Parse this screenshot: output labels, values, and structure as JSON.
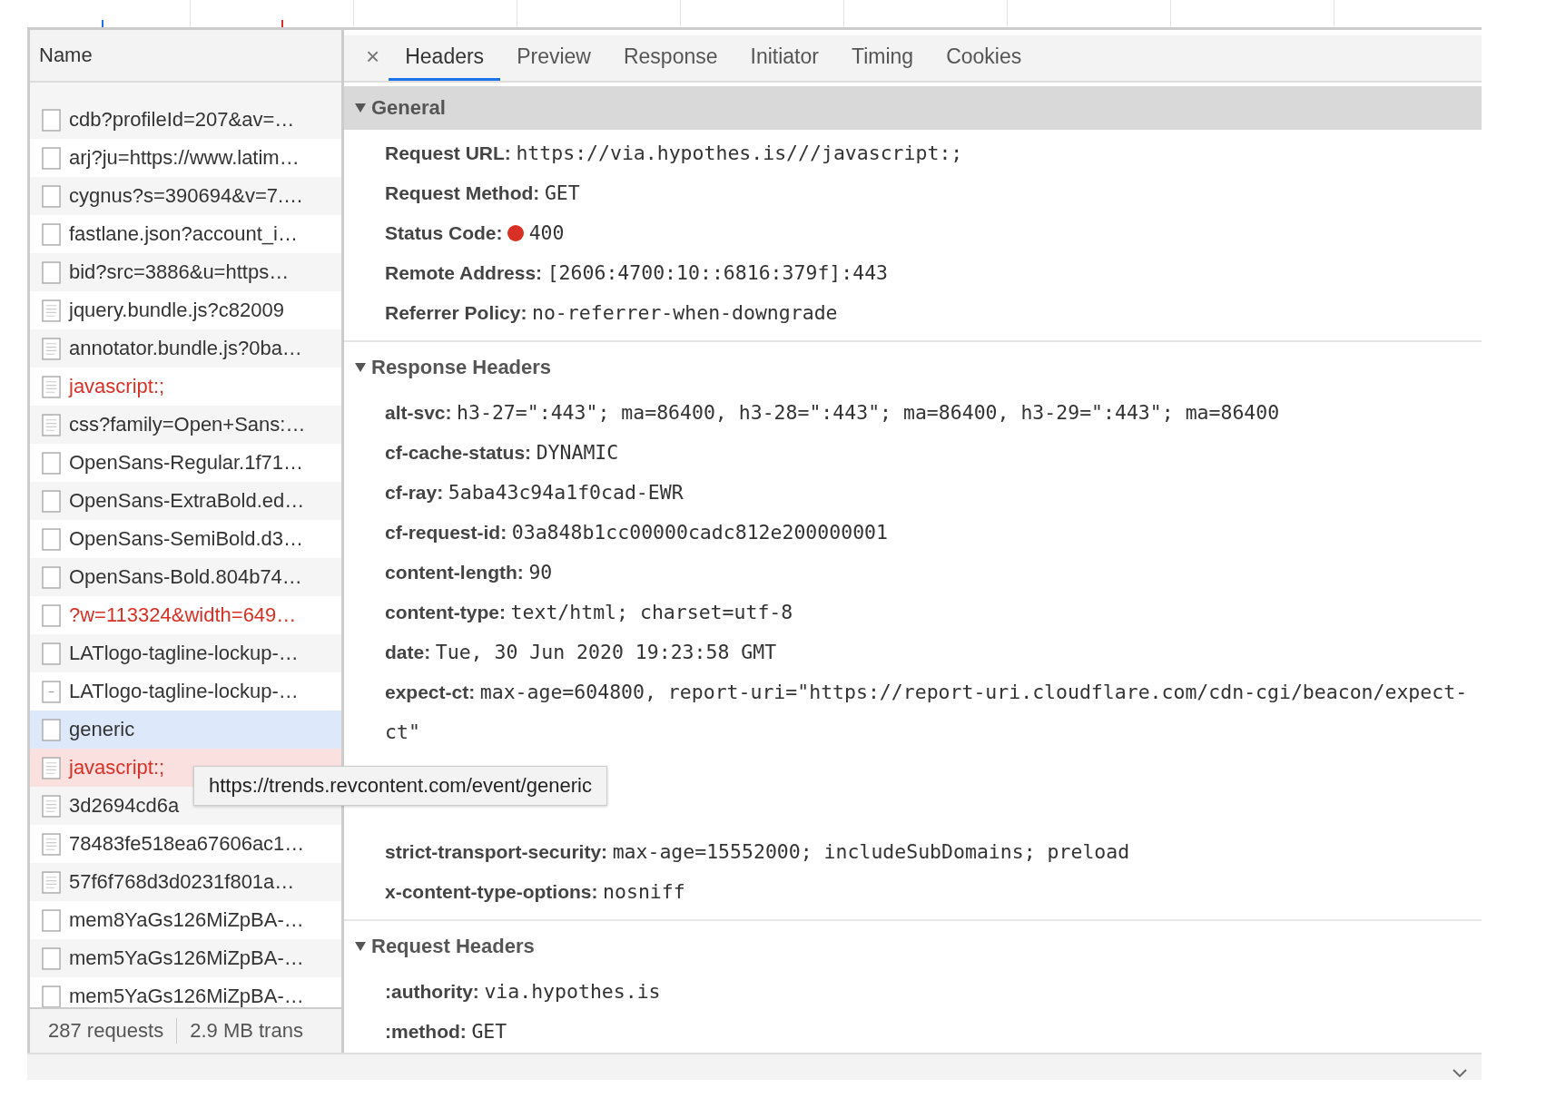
{
  "requests": {
    "column_header": "Name",
    "rows": [
      {
        "name": "cdb?profileId=207&av=…",
        "kind": "blank",
        "error": false,
        "selected": false,
        "hovered": false
      },
      {
        "name": "arj?ju=https://www.latim…",
        "kind": "blank",
        "error": false,
        "selected": false,
        "hovered": false
      },
      {
        "name": "cygnus?s=390694&v=7.…",
        "kind": "blank",
        "error": false,
        "selected": false,
        "hovered": false
      },
      {
        "name": "fastlane.json?account_i…",
        "kind": "blank",
        "error": false,
        "selected": false,
        "hovered": false
      },
      {
        "name": "bid?src=3886&u=https…",
        "kind": "blank",
        "error": false,
        "selected": false,
        "hovered": false
      },
      {
        "name": "jquery.bundle.js?c82009",
        "kind": "doc",
        "error": false,
        "selected": false,
        "hovered": false
      },
      {
        "name": "annotator.bundle.js?0ba…",
        "kind": "doc",
        "error": false,
        "selected": false,
        "hovered": false
      },
      {
        "name": "javascript:;",
        "kind": "doc",
        "error": true,
        "selected": false,
        "hovered": false
      },
      {
        "name": "css?family=Open+Sans:…",
        "kind": "doc",
        "error": false,
        "selected": false,
        "hovered": false
      },
      {
        "name": "OpenSans-Regular.1f71…",
        "kind": "blank",
        "error": false,
        "selected": false,
        "hovered": false
      },
      {
        "name": "OpenSans-ExtraBold.ed…",
        "kind": "blank",
        "error": false,
        "selected": false,
        "hovered": false
      },
      {
        "name": "OpenSans-SemiBold.d3…",
        "kind": "blank",
        "error": false,
        "selected": false,
        "hovered": false
      },
      {
        "name": "OpenSans-Bold.804b74…",
        "kind": "blank",
        "error": false,
        "selected": false,
        "hovered": false
      },
      {
        "name": "?w=113324&width=649…",
        "kind": "blank",
        "error": true,
        "selected": false,
        "hovered": false
      },
      {
        "name": "LATlogo-tagline-lockup-…",
        "kind": "blank",
        "error": false,
        "selected": false,
        "hovered": false
      },
      {
        "name": "LATlogo-tagline-lockup-…",
        "kind": "dash",
        "error": false,
        "selected": false,
        "hovered": false
      },
      {
        "name": "generic",
        "kind": "blank",
        "error": false,
        "selected": true,
        "hovered": false
      },
      {
        "name": "javascript:;",
        "kind": "doc",
        "error": true,
        "selected": false,
        "hovered": true
      },
      {
        "name": "3d2694cd6a",
        "kind": "doc",
        "error": false,
        "selected": false,
        "hovered": false
      },
      {
        "name": "78483fe518ea67606ac1…",
        "kind": "doc",
        "error": false,
        "selected": false,
        "hovered": false
      },
      {
        "name": "57f6f768d3d0231f801a…",
        "kind": "doc",
        "error": false,
        "selected": false,
        "hovered": false
      },
      {
        "name": "mem8YaGs126MiZpBA-…",
        "kind": "blank",
        "error": false,
        "selected": false,
        "hovered": false
      },
      {
        "name": "mem5YaGs126MiZpBA-…",
        "kind": "blank",
        "error": false,
        "selected": false,
        "hovered": false
      },
      {
        "name": "mem5YaGs126MiZpBA-…",
        "kind": "blank",
        "error": false,
        "selected": false,
        "hovered": false
      }
    ],
    "status_bar": [
      "287 requests",
      "2.9 MB trans"
    ]
  },
  "close": "×",
  "tabs": [
    {
      "label": "Headers",
      "selected": true
    },
    {
      "label": "Preview",
      "selected": false
    },
    {
      "label": "Response",
      "selected": false
    },
    {
      "label": "Initiator",
      "selected": false
    },
    {
      "label": "Timing",
      "selected": false
    },
    {
      "label": "Cookies",
      "selected": false
    }
  ],
  "sections": [
    {
      "title": "General",
      "expanded": true,
      "highlighted": true,
      "items": [
        {
          "kind": "pair",
          "key": "Request URL:",
          "value": "https://via.hypothes.is///javascript:;"
        },
        {
          "kind": "pair",
          "key": "Request Method:",
          "value": "GET"
        },
        {
          "kind": "status",
          "key": "Status Code:",
          "value": "400",
          "color": "#d93025"
        },
        {
          "kind": "pair",
          "key": "Remote Address:",
          "value": "[2606:4700:10::6816:379f]:443"
        },
        {
          "kind": "pair",
          "key": "Referrer Policy:",
          "value": "no-referrer-when-downgrade"
        }
      ]
    },
    {
      "title": "Response Headers",
      "expanded": true,
      "highlighted": false,
      "items": [
        {
          "kind": "pair",
          "key": "alt-svc:",
          "value": "h3-27=\":443\"; ma=86400, h3-28=\":443\"; ma=86400, h3-29=\":443\"; ma=86400"
        },
        {
          "kind": "pair",
          "key": "cf-cache-status:",
          "value": "DYNAMIC"
        },
        {
          "kind": "pair",
          "key": "cf-ray:",
          "value": "5aba43c94a1f0cad-EWR"
        },
        {
          "kind": "pair",
          "key": "cf-request-id:",
          "value": "03a848b1cc00000cadc812e200000001"
        },
        {
          "kind": "pair",
          "key": "content-length:",
          "value": "90"
        },
        {
          "kind": "pair",
          "key": "content-type:",
          "value": "text/html; charset=utf-8"
        },
        {
          "kind": "pair",
          "key": "date:",
          "value": "Tue, 30 Jun 2020 19:23:58 GMT"
        },
        {
          "kind": "pair",
          "key": "expect-ct:",
          "value": "max-age=604800, report-uri=\"https://report-uri.cloudflare.com/cdn-cgi/beacon/expect-ct\""
        },
        {
          "kind": "covered"
        },
        {
          "kind": "covered"
        },
        {
          "kind": "pair",
          "key": "strict-transport-security:",
          "value": "max-age=15552000; includeSubDomains; preload"
        },
        {
          "kind": "pair",
          "key": "x-content-type-options:",
          "value": "nosniff"
        }
      ]
    },
    {
      "title": "Request Headers",
      "expanded": true,
      "highlighted": false,
      "items": [
        {
          "kind": "pair",
          "key": ":authority:",
          "value": "via.hypothes.is"
        },
        {
          "kind": "pair",
          "key": ":method:",
          "value": "GET"
        }
      ]
    }
  ],
  "tooltip": "https://trends.revcontent.com/event/generic"
}
